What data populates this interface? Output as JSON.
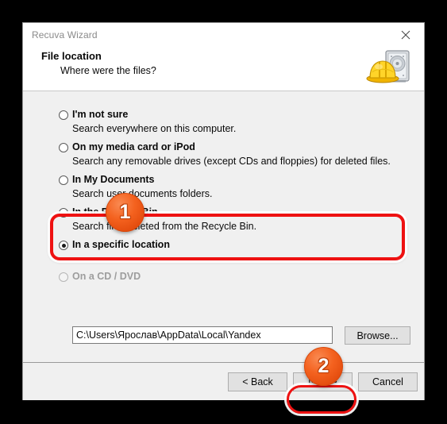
{
  "window": {
    "title": "Recuva Wizard",
    "close_icon": "close-icon"
  },
  "header": {
    "title": "File location",
    "subtitle": "Where were the files?",
    "logo_icon": "recuva-hardhat-harddrive-icon"
  },
  "options": [
    {
      "label": "I'm not sure",
      "description": "Search everywhere on this computer.",
      "selected": false,
      "disabled": false
    },
    {
      "label": "On my media card or iPod",
      "description": "Search any removable drives (except CDs and floppies) for deleted files.",
      "selected": false,
      "disabled": false
    },
    {
      "label": "In My Documents",
      "description": "Search user documents folders.",
      "selected": false,
      "disabled": false
    },
    {
      "label": "In the Recycle Bin",
      "description": "Search files deleted from the Recycle Bin.",
      "selected": false,
      "disabled": false
    },
    {
      "label": "In a specific location",
      "description": "",
      "selected": true,
      "disabled": false
    },
    {
      "label": "On a CD / DVD",
      "description": "",
      "selected": false,
      "disabled": true
    }
  ],
  "location": {
    "path_value": "C:\\Users\\Ярослав\\AppData\\Local\\Yandex",
    "path_placeholder": "",
    "browse_label": "Browse...",
    "cd_dropdown_value": "",
    "cd_dropdown_icon": "chevron-down-icon"
  },
  "footer": {
    "back_label": "< Back",
    "next_label": "Next >",
    "cancel_label": "Cancel"
  },
  "annotations": {
    "badge_1": "1",
    "badge_2": "2",
    "highlight_color": "#ee1111",
    "badge_color": "#f4621f"
  }
}
